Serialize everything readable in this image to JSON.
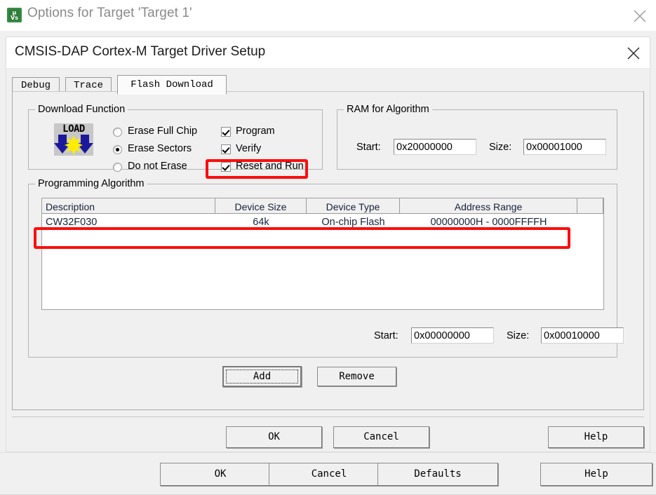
{
  "outer_window": {
    "title": "Options for Target 'Target 1'",
    "icon": "keil-uvision-icon",
    "close_icon": "close-icon"
  },
  "inner_dialog": {
    "title": "CMSIS-DAP Cortex-M Target Driver Setup",
    "close_icon": "close-icon"
  },
  "tabs": [
    {
      "label": "Debug",
      "active": false
    },
    {
      "label": "Trace",
      "active": false
    },
    {
      "label": "Flash Download",
      "active": true
    }
  ],
  "download_function": {
    "group_label": "Download Function",
    "icon_label": "LOAD",
    "radios": [
      {
        "label": "Erase Full Chip",
        "selected": false
      },
      {
        "label": "Erase Sectors",
        "selected": true
      },
      {
        "label": "Do not Erase",
        "selected": false
      }
    ],
    "checkboxes": [
      {
        "label": "Program",
        "checked": true
      },
      {
        "label": "Verify",
        "checked": true
      },
      {
        "label": "Reset and Run",
        "checked": true,
        "highlighted": true
      }
    ]
  },
  "ram_for_algorithm": {
    "group_label": "RAM for Algorithm",
    "start_label": "Start:",
    "start_value": "0x20000000",
    "size_label": "Size:",
    "size_value": "0x00001000"
  },
  "programming_algorithm": {
    "group_label": "Programming Algorithm",
    "columns": [
      "Description",
      "Device Size",
      "Device Type",
      "Address Range",
      ""
    ],
    "rows": [
      {
        "description": "CW32F030",
        "device_size": "64k",
        "device_type": "On-chip Flash",
        "address_range": "00000000H - 0000FFFFH",
        "highlighted": true
      }
    ],
    "start_label": "Start:",
    "start_value": "0x00000000",
    "size_label": "Size:",
    "size_value": "0x00010000",
    "add_button": "Add",
    "remove_button": "Remove"
  },
  "inner_buttons": {
    "ok": "OK",
    "cancel": "Cancel",
    "help": "Help"
  },
  "outer_buttons": {
    "ok": "OK",
    "cancel": "Cancel",
    "defaults": "Defaults",
    "help": "Help"
  },
  "colors": {
    "annotation_red": "#fc0d0d",
    "dialog_face": "#f0f0f0",
    "title_text_outer": "#8a8a8a",
    "icon_green": "#3a8c44",
    "load_blue": "#1c189c",
    "load_yellow": "#ffed00"
  }
}
